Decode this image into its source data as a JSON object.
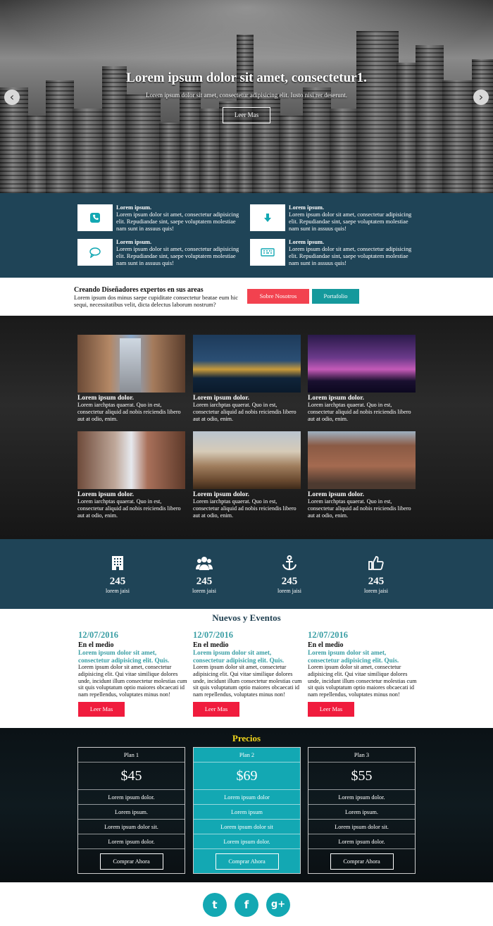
{
  "hero": {
    "title": "Lorem ipsum dolor sit amet, consectetur1.",
    "subtitle": "Lorem ipsum dolor sit amet, consectetur adipisicing elit. Iusto nisi rer deserunt.",
    "button": "Leer Mas",
    "prev_icon": "chevron-left-icon",
    "next_icon": "chevron-right-icon"
  },
  "features": [
    {
      "icon": "phone-icon",
      "title": "Lorem ipsum.",
      "text": "Lorem ipsum dolor sit amet, consectetur adipisicing elit. Repudiandae sint, saepe voluptatem molestiae nam sunt in assuus quis!"
    },
    {
      "icon": "download-icon",
      "title": "Lorem ipsum.",
      "text": "Lorem ipsum dolor sit amet, consectetur adipisicing elit. Repudiandae sint, saepe voluptatem molestiae nam sunt in assuus quis!"
    },
    {
      "icon": "chat-icon",
      "title": "Lorem ipsum.",
      "text": "Lorem ipsum dolor sit amet, consectetur adipisicing elit. Repudiandae sint, saepe voluptatem molestiae nam sunt in assuus quis!"
    },
    {
      "icon": "keyboard-icon",
      "title": "Lorem ipsum.",
      "text": "Lorem ipsum dolor sit amet, consectetur adipisicing elit. Repudiandae sint, saepe voluptatem molestiae nam sunt in assuus quis!"
    }
  ],
  "cta": {
    "title": "Creando Diseñadores expertos en sus areas",
    "text": "Lorem ipsum dos minus saepe cupiditate consectetur beatae eum hic sequi, necessitatibus velit, dicta delectus laborum nostrum?",
    "btn_about": "Sobre Nosotros",
    "btn_portfolio": "Portafolio"
  },
  "gallery": [
    {
      "title": "Lorem ipsum dolor.",
      "text": "Lorem iarchptas quaerat. Quo in est, consectetur aliquid ad nobis reiciendis libero aut at odio, enim."
    },
    {
      "title": "Lorem ipsum dolor.",
      "text": "Lorem iarchptas quaerat. Quo in est, consectetur aliquid ad nobis reiciendis libero aut at odio, enim."
    },
    {
      "title": "Lorem ipsum dolor.",
      "text": "Lorem iarchptas quaerat. Quo in est, consectetur aliquid ad nobis reiciendis libero aut at odio, enim."
    },
    {
      "title": "Lorem ipsum dolor.",
      "text": "Lorem iarchptas quaerat. Quo in est, consectetur aliquid ad nobis reiciendis libero aut at odio, enim."
    },
    {
      "title": "Lorem ipsum dolor.",
      "text": "Lorem iarchptas quaerat. Quo in est, consectetur aliquid ad nobis reiciendis libero aut at odio, enim."
    },
    {
      "title": "Lorem ipsum dolor.",
      "text": "Lorem iarchptas quaerat. Quo in est, consectetur aliquid ad nobis reiciendis libero aut at odio, enim."
    }
  ],
  "stats": [
    {
      "icon": "building-icon",
      "value": "245",
      "label": "lorem jaisi"
    },
    {
      "icon": "users-icon",
      "value": "245",
      "label": "lorem jaisi"
    },
    {
      "icon": "anchor-icon",
      "value": "245",
      "label": "lorem jaisi"
    },
    {
      "icon": "thumbs-up-icon",
      "value": "245",
      "label": "lorem jaisi"
    }
  ],
  "news": {
    "title": "Nuevos y Eventos",
    "items": [
      {
        "date": "12/07/2016",
        "heading": "En el medio",
        "subheading": "Lorem ipsum dolor sit amet, consectetur adipisicing elit. Quis.",
        "body": "Lorem ipsum dolor sit amet, consectetur adipisicing elit. Qui vitae similique dolores unde, incidunt illum consectetur molestias cum sit quis voluptatum optio maiores obcaecati id nam repellendus, voluptates minus non!",
        "button": "Leer Mas"
      },
      {
        "date": "12/07/2016",
        "heading": "En el medio",
        "subheading": "Lorem ipsum dolor sit amet, consectetur adipisicing elit. Quis.",
        "body": "Lorem ipsum dolor sit amet, consectetur adipisicing elit. Qui vitae similique dolores unde, incidunt illum consectetur molestias cum sit quis voluptatum optio maiores obcaecati id nam repellendus, voluptates minus non!",
        "button": "Leer Mas"
      },
      {
        "date": "12/07/2016",
        "heading": "En el medio",
        "subheading": "Lorem ipsum dolor sit amet, consectetur adipisicing elit. Quis.",
        "body": "Lorem ipsum dolor sit amet, consectetur adipisicing elit. Qui vitae similique dolores unde, incidunt illum consectetur molestias cum sit quis voluptatum optio maiores obcaecati id nam repellendus, voluptates minus non!",
        "button": "Leer Mas"
      }
    ]
  },
  "pricing": {
    "title": "Precios",
    "plans": [
      {
        "name": "Plan 1",
        "price": "$45",
        "features": [
          "Lorem ipsum dolor.",
          "Lorem ipsum.",
          "Lorem ipsum dolor sit.",
          "Lorem ipsum dolor."
        ],
        "button": "Comprar Ahora"
      },
      {
        "name": "Plan 2",
        "price": "$69",
        "features": [
          "Lorem ipsum dolor",
          "Lorem ipsum",
          "Lorem ipsum dolor sit",
          "Lorem ipsum dolor."
        ],
        "button": "Comprar Ahora"
      },
      {
        "name": "Plan 3",
        "price": "$55",
        "features": [
          "Lorem ipsum dolor.",
          "Lorem ipsum.",
          "Lorem ipsum dolor sit.",
          "Lorem ipsum dolor."
        ],
        "button": "Comprar Ahora"
      }
    ]
  },
  "social": [
    {
      "icon": "twitter-icon",
      "glyph": "t"
    },
    {
      "icon": "facebook-icon",
      "glyph": "f"
    },
    {
      "icon": "google-plus-icon",
      "glyph": "g+"
    }
  ],
  "colors": {
    "teal_dark": "#1f4457",
    "teal": "#13a8b3",
    "red": "#f2424f",
    "news_accent": "#3a9ea4",
    "price_title": "#f1d61c"
  }
}
